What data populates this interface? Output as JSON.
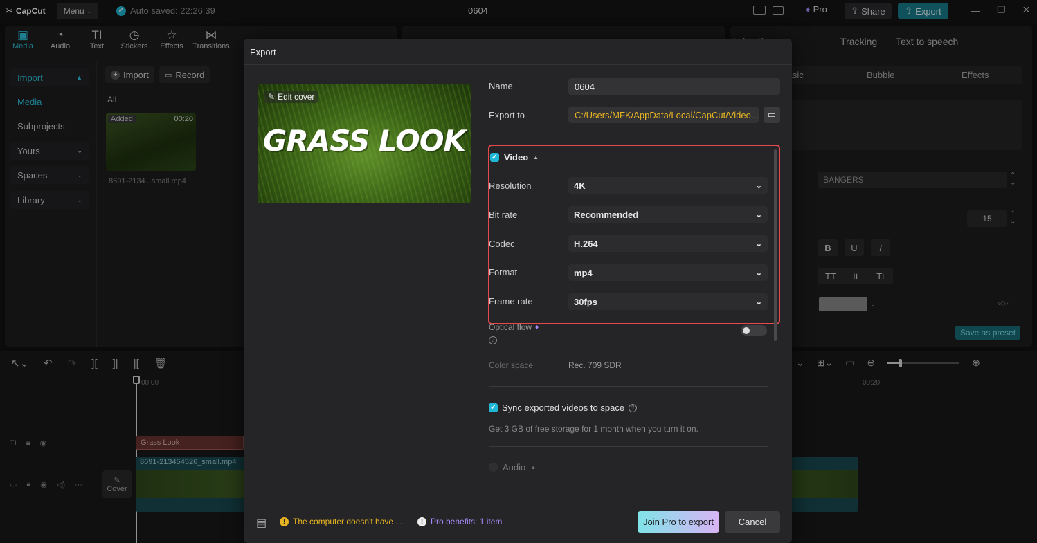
{
  "app": {
    "name": "CapCut",
    "menu_label": "Menu",
    "autosave": "Auto saved: 22:26:39",
    "project_title": "0604",
    "pro_label": "Pro",
    "share_label": "Share",
    "export_label": "Export"
  },
  "media_tabs": [
    {
      "label": "Media",
      "icon": "media-icon"
    },
    {
      "label": "Audio",
      "icon": "audio-icon"
    },
    {
      "label": "Text",
      "icon": "text-icon"
    },
    {
      "label": "Stickers",
      "icon": "stickers-icon"
    },
    {
      "label": "Effects",
      "icon": "effects-icon"
    },
    {
      "label": "Transitions",
      "icon": "transitions-icon"
    }
  ],
  "sidebar": {
    "items": [
      "Import",
      "Media",
      "Subprojects",
      "Yours",
      "Spaces",
      "Library"
    ]
  },
  "media_panel": {
    "import_label": "Import",
    "record_label": "Record",
    "filter": "All",
    "clip": {
      "badge": "Added",
      "duration": "00:20",
      "filename": "8691-2134...small.mp4"
    }
  },
  "right_panel": {
    "tabs": [
      "Animation",
      "Tracking",
      "Text to speech"
    ],
    "subtabs": [
      "Basic",
      "Bubble",
      "Effects"
    ],
    "font": "BANGERS",
    "font_size": "15",
    "style_buttons": [
      "B",
      "U",
      "I"
    ],
    "case_buttons": [
      "TT",
      "tt",
      "Tt"
    ],
    "save_preset": "Save as preset"
  },
  "timeline": {
    "time_start": "00:00",
    "time_mark": "00:20",
    "text_clip": "Grass Look",
    "video_clip": "8691-213454526_small.mp4",
    "cover_label": "Cover"
  },
  "export_dialog": {
    "title": "Export",
    "edit_cover": "Edit cover",
    "cover_text": "GRASS LOOK",
    "name_label": "Name",
    "name_value": "0604",
    "export_to_label": "Export to",
    "export_to_value": "C:/Users/MFK/AppData/Local/CapCut/Video...",
    "video_section": "Video",
    "settings": [
      {
        "label": "Resolution",
        "value": "4K"
      },
      {
        "label": "Bit rate",
        "value": "Recommended"
      },
      {
        "label": "Codec",
        "value": "H.264"
      },
      {
        "label": "Format",
        "value": "mp4"
      },
      {
        "label": "Frame rate",
        "value": "30fps"
      }
    ],
    "optical_flow": "Optical flow",
    "color_space_label": "Color space",
    "color_space_value": "Rec. 709 SDR",
    "sync_label": "Sync exported videos to space",
    "sync_note": "Get 3 GB of free storage for 1 month when you turn it on.",
    "audio_section": "Audio",
    "warning": "The computer doesn't have ...",
    "pro_benefits": "Pro benefits: 1 item",
    "join_pro": "Join Pro to export",
    "cancel": "Cancel"
  },
  "colors": {
    "accent": "#20b8d6",
    "highlight_border": "#e5484d",
    "warning": "#e6b422",
    "pro_purple": "#a78bfa"
  }
}
